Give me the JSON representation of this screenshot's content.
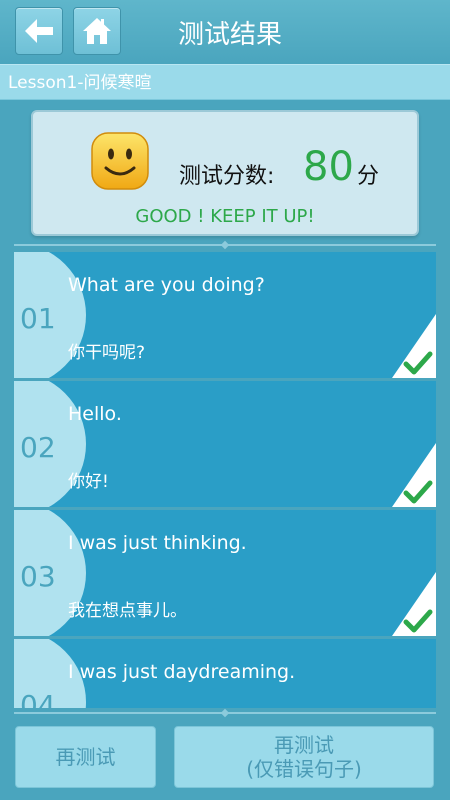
{
  "header": {
    "title": "测试结果"
  },
  "lesson": {
    "title": "Lesson1-问候寒暄"
  },
  "score": {
    "label": "测试分数:",
    "value": "80",
    "unit": "分",
    "message": "GOOD ! KEEP IT UP!"
  },
  "items": [
    {
      "num": "01",
      "en": "What are you doing?",
      "zh": "你干吗呢?",
      "correct": true
    },
    {
      "num": "02",
      "en": "Hello.",
      "zh": "你好!",
      "correct": true
    },
    {
      "num": "03",
      "en": "I was just thinking.",
      "zh": "我在想点事儿。",
      "correct": true
    },
    {
      "num": "04",
      "en": "I was just daydreaming.",
      "zh": "",
      "correct": false
    }
  ],
  "buttons": {
    "retest": "再测试",
    "retest_wrong_line1": "再测试",
    "retest_wrong_line2": "(仅错误句子)"
  },
  "colors": {
    "accent": "#2da84a",
    "item_bg": "#2a9ec7",
    "header_bg": "#4aa5be"
  }
}
